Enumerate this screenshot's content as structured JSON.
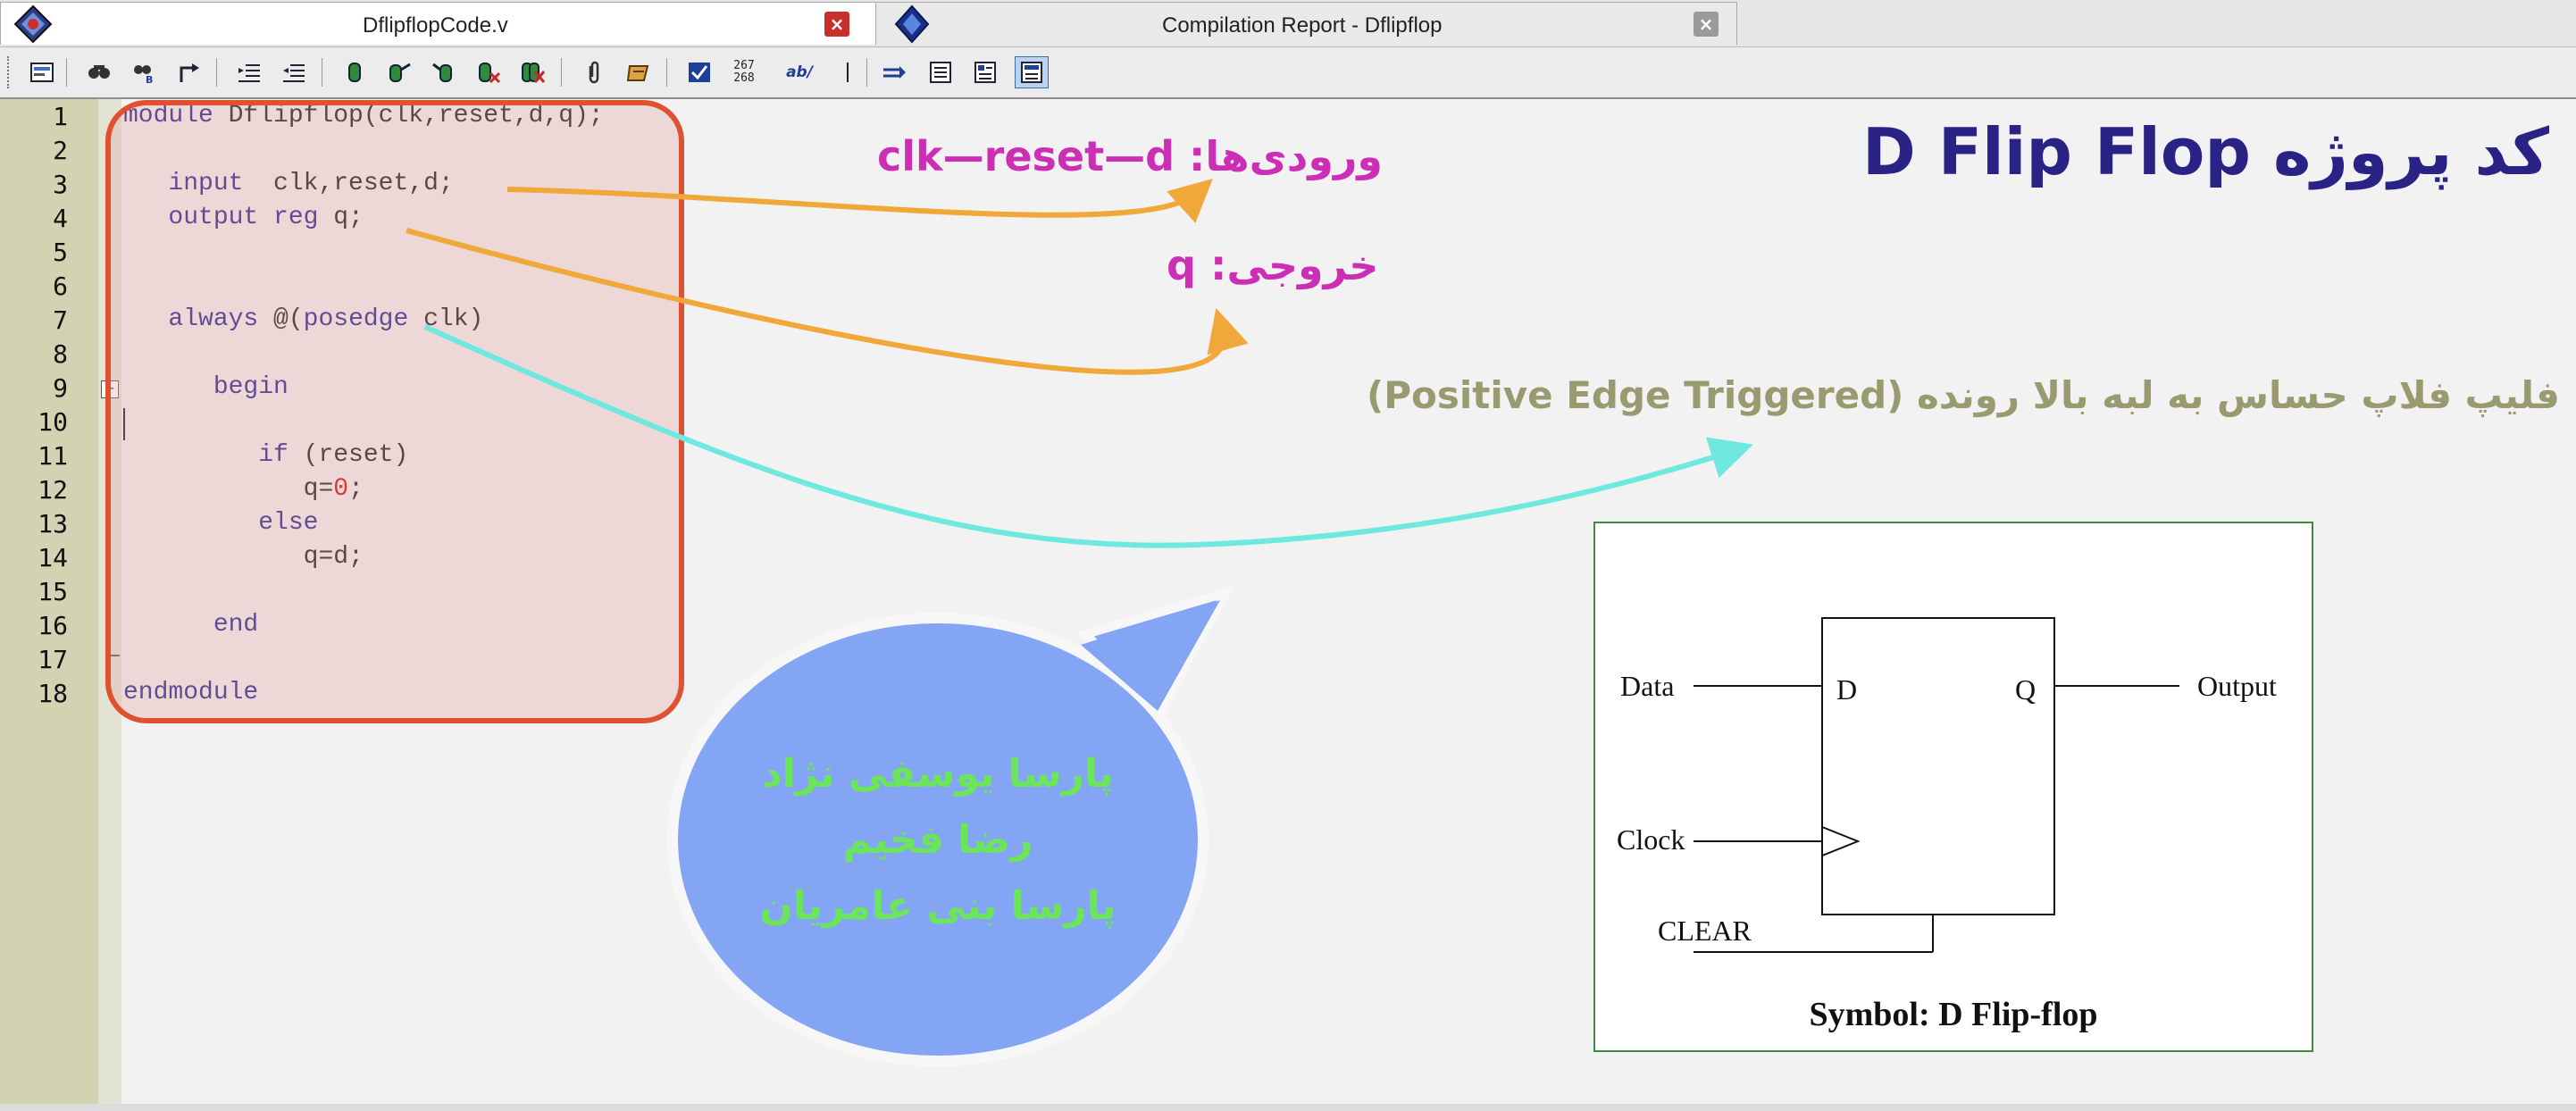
{
  "tabs": [
    {
      "title": "DflipflopCode.v",
      "close": "×"
    },
    {
      "title": "Compilation Report - Dflipflop",
      "close": "×"
    }
  ],
  "toolbar": {
    "line_numbers_label_top": "267",
    "line_numbers_label_bottom": "268",
    "ab_label": "ab/",
    "icons": [
      "insert-template-icon",
      "find-icon",
      "find-replace-icon",
      "goto-icon",
      "indent-icon",
      "unindent-icon",
      "bookmark-icon",
      "next-bookmark-icon",
      "prev-bookmark-icon",
      "clear-bookmark-icon",
      "clear-all-bookmarks-icon",
      "attach-icon",
      "comment-icon",
      "check-icon",
      "line-numbers-icon",
      "replace-text-icon",
      "cursor-icon",
      "arrow-right-icon",
      "view-list-icon",
      "view-detail-icon",
      "view-active-icon"
    ]
  },
  "editor": {
    "line_numbers": [
      "1",
      "2",
      "3",
      "4",
      "5",
      "6",
      "7",
      "8",
      "9",
      "10",
      "11",
      "12",
      "13",
      "14",
      "15",
      "16",
      "17",
      "18"
    ],
    "lines": [
      {
        "n": 1,
        "indent": "",
        "parts": [
          {
            "t": "module",
            "k": "kw"
          },
          {
            "t": " Dflipflop(clk,reset,d,q);",
            "k": ""
          }
        ]
      },
      {
        "n": 2,
        "indent": "",
        "parts": []
      },
      {
        "n": 3,
        "indent": "   ",
        "parts": [
          {
            "t": "input",
            "k": "kw"
          },
          {
            "t": "  clk,reset,d;",
            "k": ""
          }
        ]
      },
      {
        "n": 4,
        "indent": "   ",
        "parts": [
          {
            "t": "output reg",
            "k": "kw"
          },
          {
            "t": " q;",
            "k": ""
          }
        ]
      },
      {
        "n": 5,
        "indent": "",
        "parts": []
      },
      {
        "n": 6,
        "indent": "",
        "parts": []
      },
      {
        "n": 7,
        "indent": "   ",
        "parts": [
          {
            "t": "always",
            "k": "kw"
          },
          {
            "t": " @(",
            "k": ""
          },
          {
            "t": "posedge",
            "k": "kw"
          },
          {
            "t": " clk)",
            "k": ""
          }
        ]
      },
      {
        "n": 8,
        "indent": "",
        "parts": []
      },
      {
        "n": 9,
        "indent": "      ",
        "parts": [
          {
            "t": "begin",
            "k": "kw"
          }
        ]
      },
      {
        "n": 10,
        "indent": "",
        "parts": []
      },
      {
        "n": 11,
        "indent": "         ",
        "parts": [
          {
            "t": "if",
            "k": "kw"
          },
          {
            "t": " (reset)",
            "k": ""
          }
        ]
      },
      {
        "n": 12,
        "indent": "            ",
        "parts": [
          {
            "t": "q=",
            "k": ""
          },
          {
            "t": "0",
            "k": "num"
          },
          {
            "t": ";",
            "k": ""
          }
        ]
      },
      {
        "n": 13,
        "indent": "         ",
        "parts": [
          {
            "t": "else",
            "k": "kw"
          }
        ]
      },
      {
        "n": 14,
        "indent": "            ",
        "parts": [
          {
            "t": "q=d;",
            "k": ""
          }
        ]
      },
      {
        "n": 15,
        "indent": "",
        "parts": []
      },
      {
        "n": 16,
        "indent": "      ",
        "parts": [
          {
            "t": "end",
            "k": "kw"
          }
        ]
      },
      {
        "n": 17,
        "indent": "",
        "parts": []
      },
      {
        "n": 18,
        "indent": "",
        "parts": [
          {
            "t": "endmodule",
            "k": "kw"
          }
        ]
      }
    ]
  },
  "slide": {
    "title": "کد پروژه  D Flip Flop",
    "inputs_annotation": "ورودی‌ها: clk—reset—d",
    "output_annotation": "خروجی: q",
    "edge_annotation": "فلیپ فلاپ حساس به لبه بالا رونده (Positive Edge Triggered)",
    "authors": [
      "پارسا یوسفی نژاد",
      "رضا فخیم",
      "پارسا بنی عامریان"
    ],
    "colors": {
      "title": "#2a2386",
      "annotation_magenta": "#cc2fb5",
      "annotation_olive": "#9a9a70",
      "arrow_orange": "#f0a83a",
      "arrow_cyan": "#6fe8e0",
      "bubble_fill": "#84a5f3",
      "bubble_text": "#6be55a",
      "code_box_border": "#e0512f"
    }
  },
  "symbol": {
    "data_label": "Data",
    "clock_label": "Clock",
    "clear_label": "CLEAR",
    "d_label": "D",
    "q_label": "Q",
    "output_label": "Output",
    "caption": "Symbol: D Flip-flop"
  }
}
